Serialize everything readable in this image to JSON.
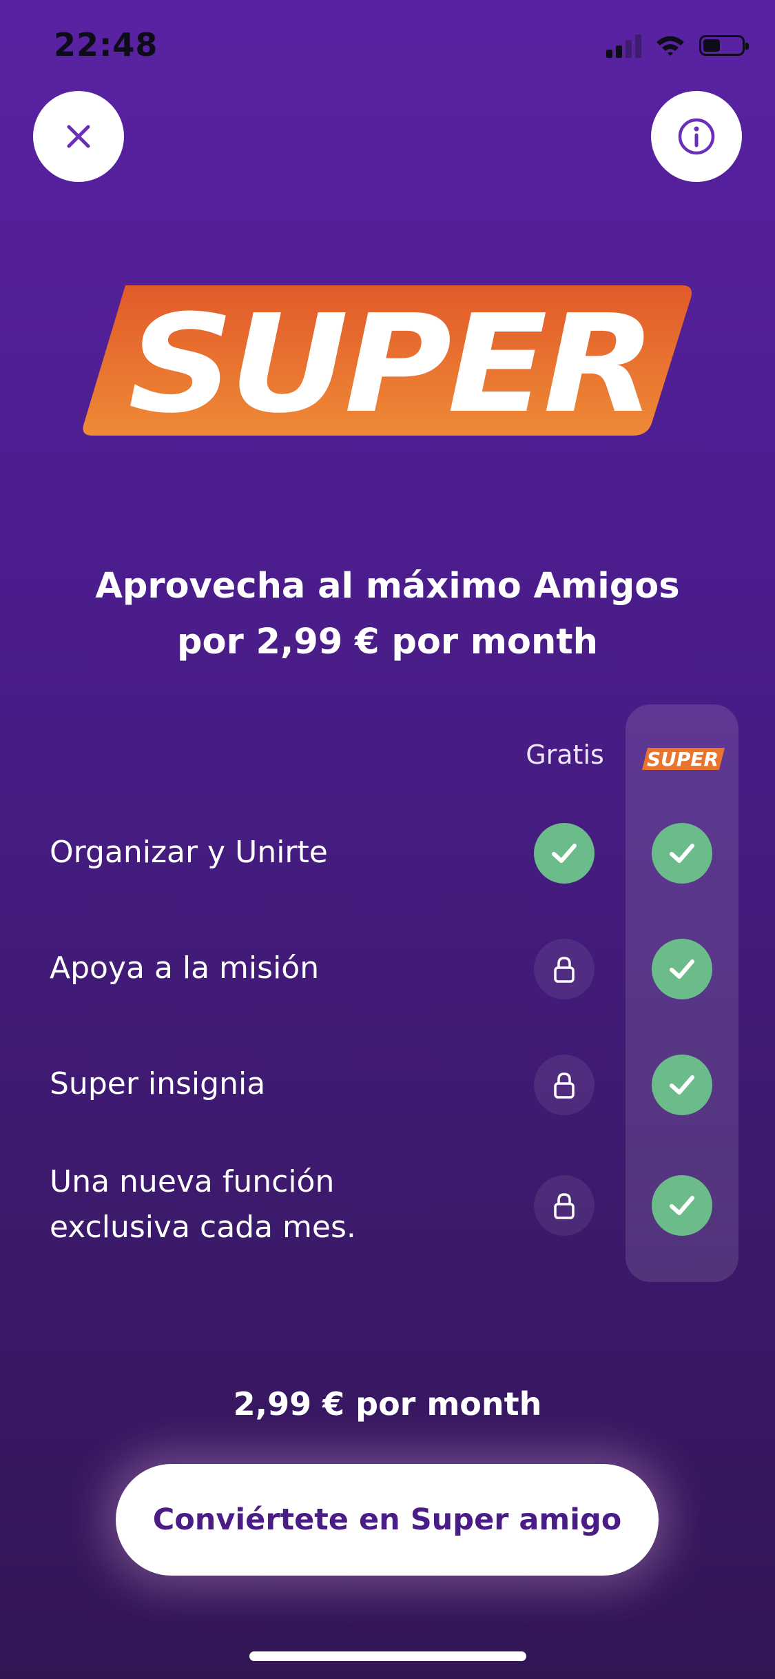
{
  "status": {
    "time": "22:48"
  },
  "header": {
    "close_icon": "close-icon",
    "info_icon": "info-icon"
  },
  "brand": {
    "logo_text": "SUPER",
    "accent_orange": "#e8742e",
    "accent_purple": "#5a22a3"
  },
  "headline": {
    "line1": "Aprovecha al máximo Amigos",
    "line2": "por 2,99 € por month"
  },
  "comparison": {
    "columns": {
      "free": "Gratis",
      "super_badge": "SUPER"
    },
    "rows": [
      {
        "label": "Organizar y Unirte",
        "free": "check",
        "super": "check"
      },
      {
        "label": "Apoya a la misión",
        "free": "lock",
        "super": "check"
      },
      {
        "label": "Super insignia",
        "free": "lock",
        "super": "check"
      },
      {
        "label_line1": "Una nueva función",
        "label_line2": "exclusiva cada mes.",
        "free": "lock",
        "super": "check"
      }
    ],
    "check_color": "#6bbb8b"
  },
  "footer": {
    "price_text": "2,99 € por month",
    "cta_prefix": "Conviértete en ",
    "cta_bold": "Super amigo"
  }
}
